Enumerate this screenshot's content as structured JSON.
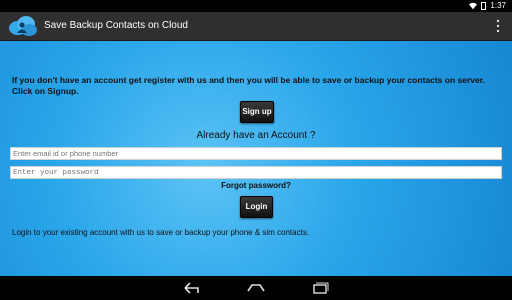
{
  "status_bar": {
    "time": "1:37"
  },
  "action_bar": {
    "title": "Save Backup Contacts on Cloud"
  },
  "intro_text": "If you don't have an account get register with us and then you will be able to save or backup your contacts on server. Click on Signup.",
  "signup": {
    "label": "Sign up"
  },
  "already_text": "Already have an Account ?",
  "email": {
    "placeholder": "Enter email id or phone number"
  },
  "password": {
    "placeholder": "Enter your password"
  },
  "forgot_text": "Forgot password?",
  "login": {
    "label": "Login"
  },
  "footer_note": "Login to your existing account with us to save or backup your phone & sim contacts.",
  "icons": {
    "app": "cloud-contacts-icon",
    "overflow": "overflow-menu-icon",
    "back": "back-icon",
    "home": "home-icon",
    "recents": "recents-icon",
    "wifi": "wifi-icon",
    "battery": "battery-icon"
  },
  "colors": {
    "background_light": "#5cc3f5",
    "background_dark": "#1687d3",
    "action_bar": "#2f2f2f",
    "button": "#111111"
  }
}
